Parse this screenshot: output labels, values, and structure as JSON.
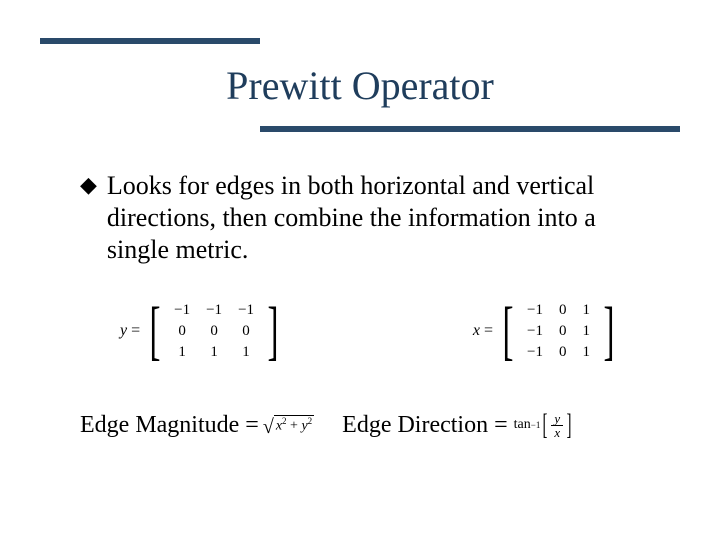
{
  "title": "Prewitt Operator",
  "bullet": "Looks for edges in both horizontal and vertical directions, then combine the information into a single metric.",
  "matrices": {
    "y": {
      "var": "y",
      "rows": [
        [
          "−1",
          "−1",
          "−1"
        ],
        [
          "0",
          "0",
          "0"
        ],
        [
          "1",
          "1",
          "1"
        ]
      ]
    },
    "x": {
      "var": "x",
      "rows": [
        [
          "−1",
          "0",
          "1"
        ],
        [
          "−1",
          "0",
          "1"
        ],
        [
          "−1",
          "0",
          "1"
        ]
      ]
    }
  },
  "labels": {
    "magnitude": "Edge Magnitude =",
    "direction": "Edge Direction ="
  },
  "formulas": {
    "magnitude_expr": {
      "under_root_terms": [
        "x",
        "y"
      ],
      "power": "2"
    },
    "direction_expr": {
      "func": "tan",
      "inv": "−1",
      "num": "y",
      "den": "x"
    }
  }
}
